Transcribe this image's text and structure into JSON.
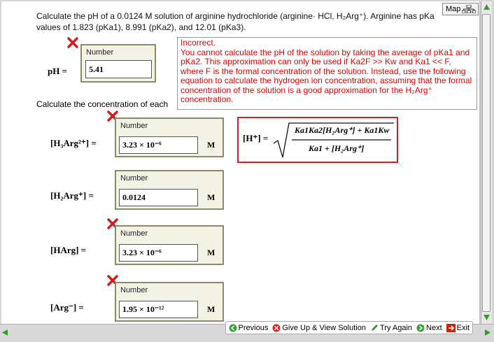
{
  "question": {
    "line1": "Calculate the pH of a 0.0124 M solution of arginine hydrochloride (arginine· HCl, H₂Arg⁺). Arginine has pKa",
    "line2": "values of 1.823 (pKa1), 8.991 (pKa2), and 12.01 (pKa3)."
  },
  "map_button": {
    "label": "Map"
  },
  "number_label": "Number",
  "ph_answer": {
    "label": "pH =",
    "value": "5.41"
  },
  "concentration_prompt": "Calculate the concentration of each",
  "feedback": {
    "title": "Incorrect.",
    "body": "You cannot calculate the pH of the solution by taking the average of pKa1 and pKa2. This approximation can only be used if Ka2F >> Kw and Ka1 << F, where F is the formal concentration of the solution. Instead, use the following equation to calculate the hydrogen ion concentration, assuming that the formal concentration of the solution is a good approximation for the H₂Arg⁺ concentration."
  },
  "formula": {
    "lhs": "[H⁺] =",
    "numerator": "Ka1Ka2[H₂Arg⁺] + Ka1Kw",
    "denominator": "Ka1 + [H₂Arg⁺]"
  },
  "species": [
    {
      "label": "[H₃Arg²⁺] =",
      "value": "3.23 × 10⁻⁶",
      "unit": "M",
      "incorrect": true
    },
    {
      "label": "[H₂Arg⁺] =",
      "value": "0.0124",
      "unit": "M",
      "incorrect": false
    },
    {
      "label": "[HArg] =",
      "value": "3.23 × 10⁻⁶",
      "unit": "M",
      "incorrect": true
    },
    {
      "label": "[Arg⁻] =",
      "value": "1.95 × 10⁻¹²",
      "unit": "M",
      "incorrect": true
    }
  ],
  "nav": {
    "previous": "Previous",
    "give_up": "Give Up & View Solution",
    "try_again": "Try Again",
    "next": "Next",
    "exit": "Exit"
  },
  "colors": {
    "error_red": "#e00000",
    "input_panel_bg": "#f3f3e5",
    "bar_green": "#3a9a2a"
  }
}
